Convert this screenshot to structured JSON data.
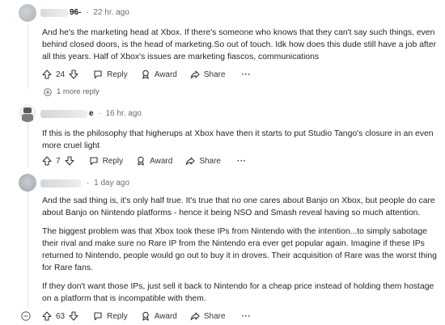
{
  "comments": [
    {
      "username": "",
      "username_visible_suffix": "96-",
      "separator": "·",
      "time": "22 hr. ago",
      "paragraphs": [
        "And he's the marketing head at Xbox. If there's someone who knows that they can't say such things, even behind closed doors, is the head of marketing.So out of touch. Idk how does this dude still have a job after all this years. Half of Xbox's issues are marketing fiascos, communications"
      ],
      "votes": "24",
      "reply_label": "Reply",
      "award_label": "Award",
      "share_label": "Share",
      "more_label": "···"
    },
    {
      "more_replies": "1 more reply",
      "username_visible_suffix": "e",
      "separator": "·",
      "time": "16 hr. ago",
      "paragraphs": [
        "If this is the philosophy that higherups at Xbox have then it starts to put Studio Tango's closure in an even more cruel light"
      ],
      "votes": "7",
      "reply_label": "Reply",
      "award_label": "Award",
      "share_label": "Share",
      "more_label": "···"
    },
    {
      "username_visible_suffix": "",
      "separator": "·",
      "time": "1 day ago",
      "paragraphs": [
        "And the sad thing is, it's only half true. It's true that no one cares about Banjo on Xbox, but people do care about Banjo on Nintendo platforms - hence it being NSO and Smash reveal having so much attention.",
        "The biggest problem was that Xbox took these IPs from Nintendo with the intention...to simply sabotage their rival and make sure no Rare IP from the Nintendo era ever get popular again. Imagine if these IPs returned to Nintendo, people would go out to buy it in droves. Their acquisition of Rare was the worst thing for Rare fans.",
        "If they don't want those IPs, just sell it back to Nintendo for a cheap price instead of holding them hostage on a platform that is incompatible with them."
      ],
      "votes": "63",
      "reply_label": "Reply",
      "award_label": "Award",
      "share_label": "Share",
      "more_label": "···"
    }
  ],
  "colors": {
    "text": "#24272b",
    "meta": "#6a6f75",
    "thread_line": "#e5e6e8"
  }
}
